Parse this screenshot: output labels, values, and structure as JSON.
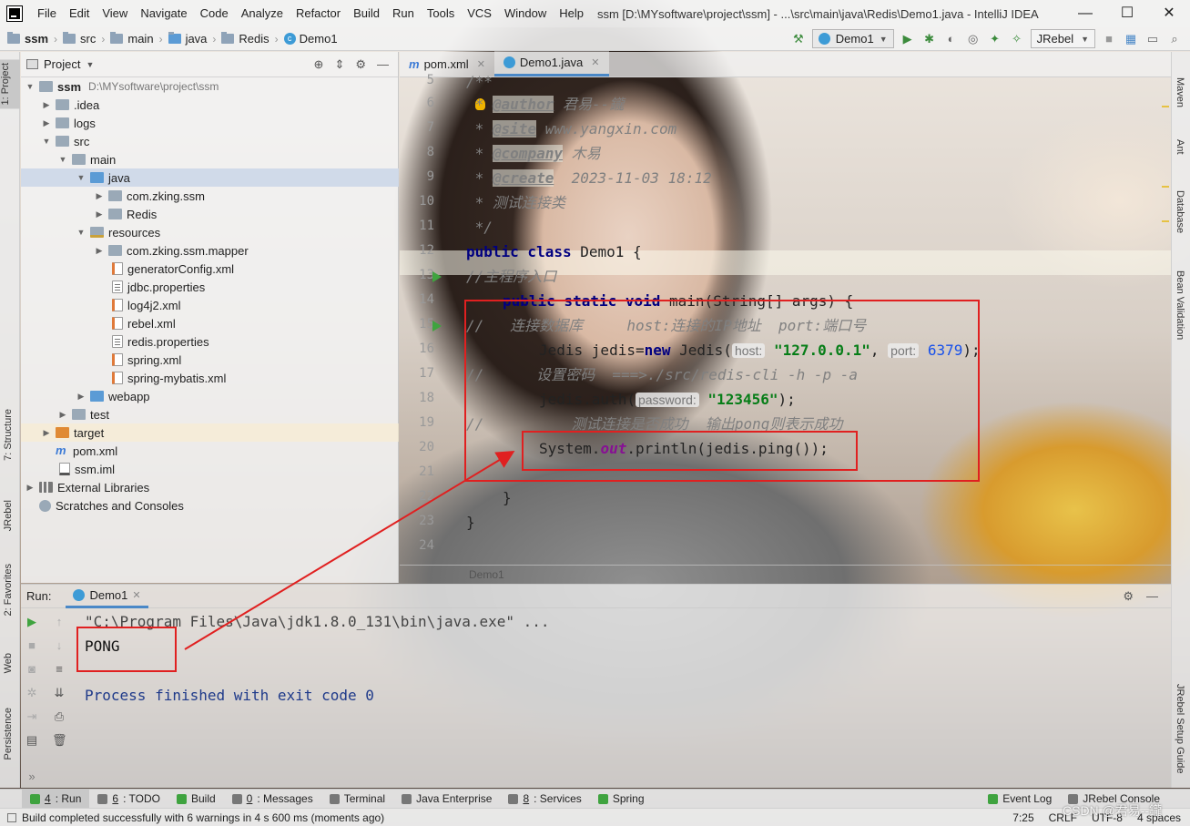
{
  "window": {
    "title": "ssm [D:\\MYsoftware\\project\\ssm] - ...\\src\\main\\java\\Redis\\Demo1.java - IntelliJ IDEA",
    "menu": [
      "File",
      "Edit",
      "View",
      "Navigate",
      "Code",
      "Analyze",
      "Refactor",
      "Build",
      "Run",
      "Tools",
      "VCS",
      "Window",
      "Help"
    ],
    "controls": {
      "minimize": "—",
      "maximize": "☐",
      "close": "✕"
    }
  },
  "breadcrumb": [
    "ssm",
    "src",
    "main",
    "java",
    "Redis",
    "Demo1"
  ],
  "toolbar": {
    "run_config": "Demo1",
    "jrebel": "JRebel"
  },
  "left_stripe": [
    "1: Project",
    "7: Structure",
    "JRebel",
    "2: Favorites",
    "Web",
    "Persistence"
  ],
  "right_stripe": [
    "Maven",
    "Ant",
    "Database",
    "Bean Validation",
    "JRebel Setup Guide"
  ],
  "project": {
    "title": "Project",
    "root_name": "ssm",
    "root_path": "D:\\MYsoftware\\project\\ssm",
    "tree": [
      ".idea",
      "logs",
      "src",
      "main",
      "java",
      "com.zking.ssm",
      "Redis",
      "resources",
      "com.zking.ssm.mapper",
      "generatorConfig.xml",
      "jdbc.properties",
      "log4j2.xml",
      "rebel.xml",
      "redis.properties",
      "spring.xml",
      "spring-mybatis.xml",
      "webapp",
      "test",
      "target",
      "pom.xml",
      "ssm.iml",
      "External Libraries",
      "Scratches and Consoles"
    ]
  },
  "editor": {
    "tabs": [
      "pom.xml",
      "Demo1.java"
    ],
    "line_numbers": [
      "5",
      "6",
      "7",
      "8",
      "9",
      "10",
      "11",
      "12",
      "13",
      "14",
      "15",
      "16",
      "17",
      "18",
      "19",
      "20",
      "21",
      "22",
      "23",
      "24"
    ],
    "breadcrumb_footer": "Demo1",
    "code": {
      "l5": "/**",
      "l6_tag": "@author",
      "l6_text": " 君易--鑨",
      "l7_tag": "@site",
      "l7_text": " www.yangxin.com",
      "l8_tag": "@company",
      "l8_text": " 木易",
      "l9_tag": "@create",
      "l9_text": "  2023-11-03 18:12",
      "l10": " * 测试连接类",
      "l11": " */",
      "l12_kw": "public class",
      "l12_rest": " Demo1 {",
      "l13": "//主程序入口",
      "l14_kw": "public static void",
      "l14_rest": " main(String[] args) {",
      "l15": "//   连接数据库     host:连接的IP地址  port:端口号",
      "l16_a": "Jedis jedis=",
      "l16_new": "new",
      "l16_b": " Jedis(",
      "l16_hint1": "host:",
      "l16_str": "\"127.0.0.1\"",
      "l16_c": ", ",
      "l16_hint2": "port:",
      "l16_num": "6379",
      "l16_d": ");",
      "l17": "//      设置密码  ===>./src/redis-cli -h -p -a",
      "l18_a": "jedis.auth(",
      "l18_hint": "password:",
      "l18_str": "\"123456\"",
      "l18_b": ");",
      "l19": "//          测试连接是否成功  输出pong则表示成功",
      "l20_a": "System.",
      "l20_out": "out",
      "l20_b": ".println(jedis.ping());",
      "l22": "}",
      "l23": "}"
    }
  },
  "run": {
    "label": "Run:",
    "tab": "Demo1",
    "command": "\"C:\\Program Files\\Java\\jdk1.8.0_131\\bin\\java.exe\" ...",
    "output": "PONG",
    "finish": "Process finished with exit code 0"
  },
  "bottom_tools": [
    {
      "num": "4",
      "label": ": Run"
    },
    {
      "num": "6",
      "label": ": TODO"
    },
    {
      "num": "",
      "label": "Build"
    },
    {
      "num": "0",
      "label": ": Messages"
    },
    {
      "num": "",
      "label": "Terminal"
    },
    {
      "num": "",
      "label": "Java Enterprise"
    },
    {
      "num": "8",
      "label": ": Services"
    },
    {
      "num": "",
      "label": "Spring"
    },
    {
      "num": "",
      "label": "Event Log"
    },
    {
      "num": "",
      "label": "JRebel Console"
    }
  ],
  "status": {
    "message": "Build completed successfully with 6 warnings in 4 s 600 ms (moments ago)",
    "position": "7:25",
    "line_sep": "CRLF",
    "encoding": "UTF-8",
    "indent": "4 spaces"
  },
  "watermark": "CSDN @君易--鑨",
  "colors": {
    "annotation": "#e02020",
    "keyword": "#000080",
    "string": "#067d17",
    "comment": "#808080"
  }
}
